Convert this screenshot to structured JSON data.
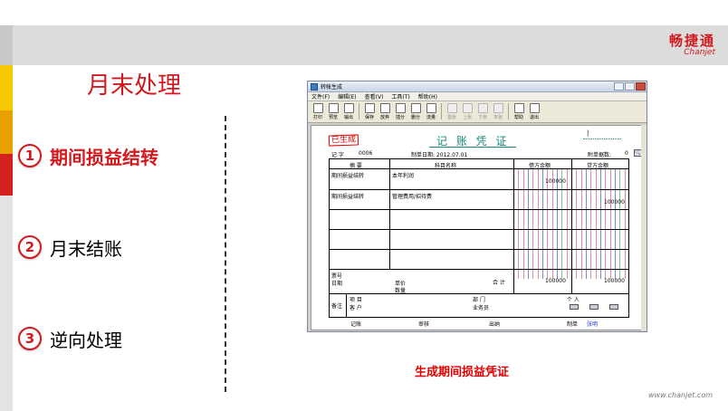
{
  "slide": {
    "title": "月末处理",
    "logo_cn": "畅捷通",
    "logo_en": "Chanjet",
    "site": "www.chanjet.com",
    "caption": "生成期间损益凭证",
    "colors": {
      "accent_red": "#d2191e",
      "teal": "#158a7a",
      "caption_red": "#e00000"
    }
  },
  "menu": [
    {
      "num": "1",
      "label": "期间损益结转",
      "active": true
    },
    {
      "num": "2",
      "label": "月末结账",
      "active": false
    },
    {
      "num": "3",
      "label": "逆向处理",
      "active": false
    }
  ],
  "window": {
    "title": "转帐生成",
    "menubar": [
      "文件(F)",
      "编辑(E)",
      "查看(V)",
      "工具(T)",
      "帮助(H)"
    ],
    "toolbar": [
      {
        "label": "打印",
        "icon": "printer-icon",
        "enabled": true
      },
      {
        "label": "预览",
        "icon": "preview-icon",
        "enabled": true
      },
      {
        "label": "输出",
        "icon": "export-icon",
        "enabled": true
      },
      {
        "label": "保存",
        "icon": "save-icon",
        "enabled": true
      },
      {
        "label": "放弃",
        "icon": "undo-icon",
        "enabled": true
      },
      {
        "label": "插分",
        "icon": "insert-row-icon",
        "enabled": true
      },
      {
        "label": "删分",
        "icon": "delete-row-icon",
        "enabled": true
      },
      {
        "label": "流量",
        "icon": "cashflow-icon",
        "enabled": true
      },
      {
        "label": "首张",
        "icon": "first-icon",
        "enabled": false
      },
      {
        "label": "上张",
        "icon": "prev-icon",
        "enabled": false
      },
      {
        "label": "下张",
        "icon": "next-icon",
        "enabled": false
      },
      {
        "label": "末张",
        "icon": "last-icon",
        "enabled": false
      },
      {
        "label": "帮助",
        "icon": "help-icon",
        "enabled": true
      },
      {
        "label": "退出",
        "icon": "exit-icon",
        "enabled": true
      }
    ],
    "voucher": {
      "stamp": "已生成",
      "title": "记 账 凭 证",
      "page_indicator": "|",
      "type_label": "记 字",
      "number": "0006",
      "date_label": "制单日期: 2012.07.01",
      "attach_label": "附单据数:",
      "attach_value": "0",
      "headers": {
        "summary": "摘 要",
        "account": "科目名称",
        "debit": "借方金额",
        "credit": "贷方金额"
      },
      "rows": [
        {
          "summary": "期间损益结转",
          "account": "本年利润",
          "debit": "100000",
          "credit": ""
        },
        {
          "summary": "期间损益结转",
          "account": "管理费用/招待费",
          "debit": "",
          "credit": "100000"
        }
      ],
      "totals": {
        "debit": "100000",
        "credit": "100000"
      },
      "bottom_labels": {
        "ticket_no": "票号",
        "date": "日期",
        "unit_price": "单价",
        "quantity": "数量",
        "total": "合 计",
        "remark": "备注",
        "project": "项 目",
        "customer": "客 户",
        "department": "部 门",
        "salesperson": "业务员",
        "person": "个 人"
      },
      "footer": {
        "bookkeeper": "记账",
        "auditor": "审核",
        "cashier": "出纳",
        "maker_label": "制单",
        "maker_name": "张明"
      }
    }
  }
}
